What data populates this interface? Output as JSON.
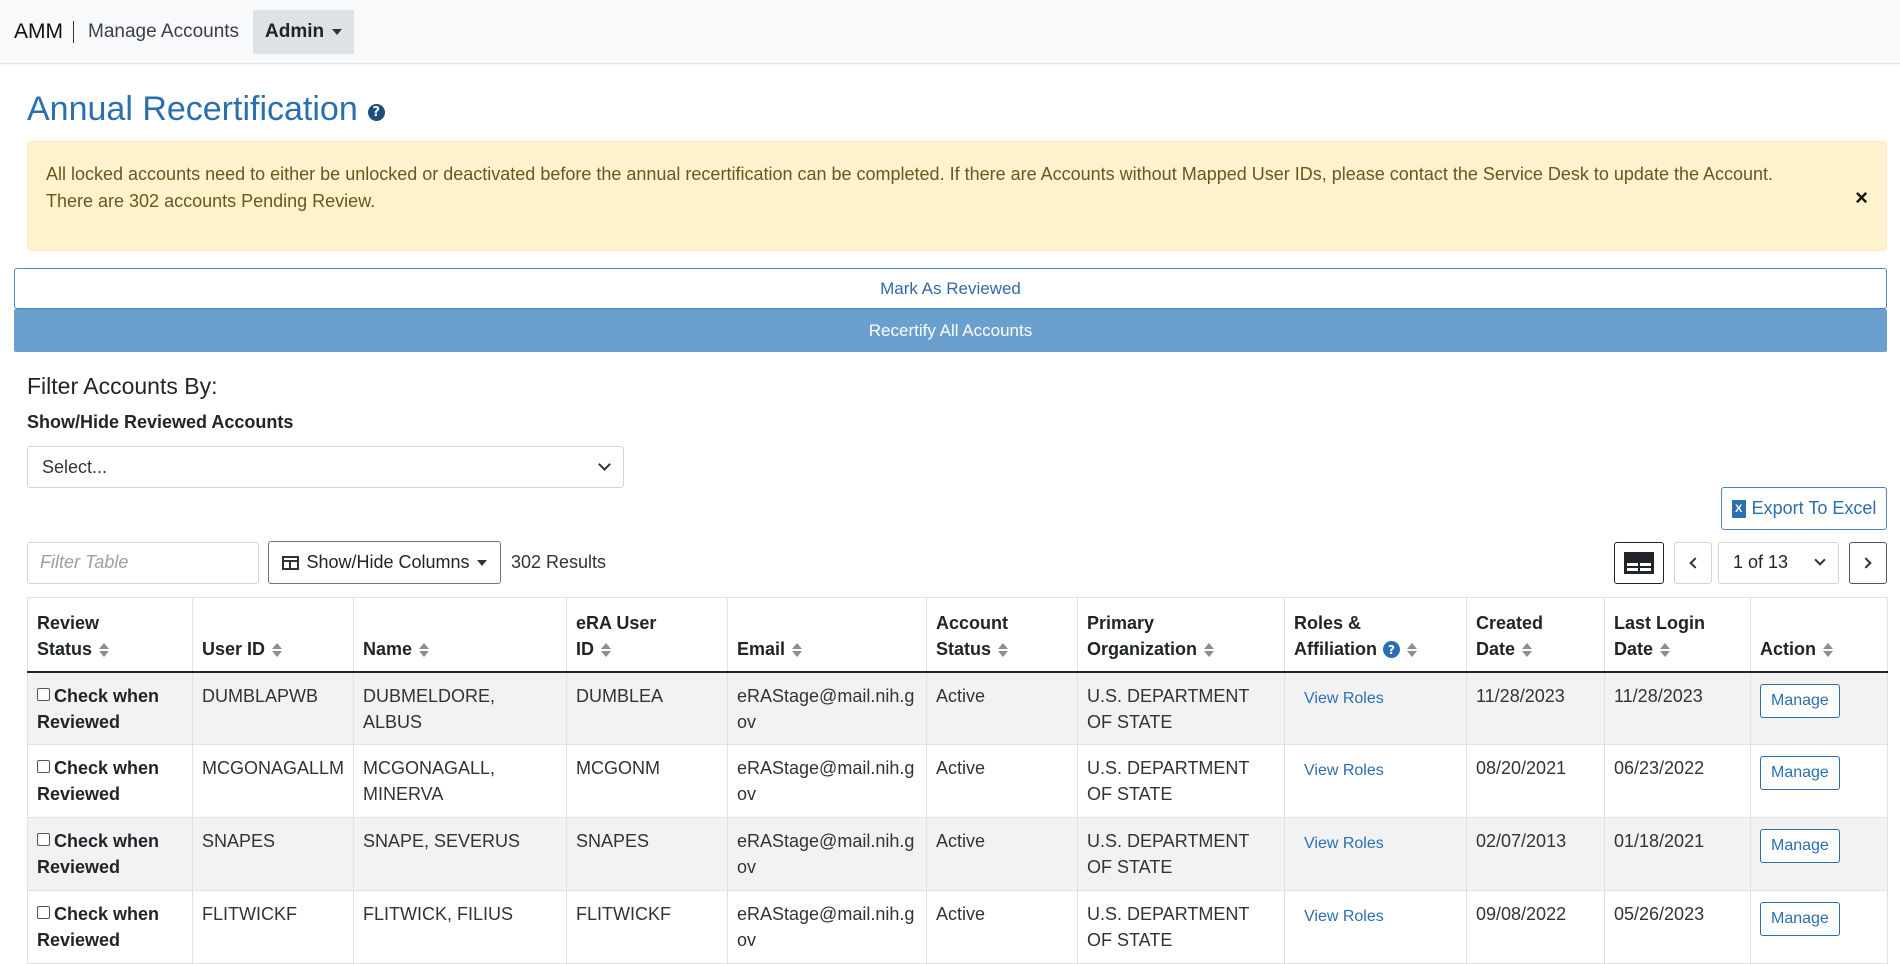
{
  "nav": {
    "brand": "AMM",
    "manage_accounts": "Manage Accounts",
    "admin": "Admin"
  },
  "page": {
    "title": "Annual Recertification",
    "help_glyph": "?"
  },
  "alert": {
    "line1": "All locked accounts need to either be unlocked or deactivated before the annual recertification can be completed. If there are Accounts without Mapped User IDs, please contact the Service Desk to update the Account.",
    "line2": "There are 302 accounts Pending Review.",
    "close": "×"
  },
  "actions": {
    "mark_reviewed": "Mark As Reviewed",
    "recertify_all": "Recertify All Accounts"
  },
  "filter": {
    "title": "Filter Accounts By:",
    "label": "Show/Hide Reviewed Accounts",
    "select_value": "Select..."
  },
  "export": {
    "label": "Export To Excel",
    "icon_glyph": "X"
  },
  "toolbar": {
    "filter_placeholder": "Filter Table",
    "show_hide_columns": "Show/Hide Columns",
    "results": "302 Results",
    "page_value": "1 of 13"
  },
  "table": {
    "headers": [
      {
        "l1": "Review",
        "l2": "Status"
      },
      {
        "l1": "",
        "l2": "User ID"
      },
      {
        "l1": "",
        "l2": "Name"
      },
      {
        "l1": "eRA User",
        "l2": "ID"
      },
      {
        "l1": "",
        "l2": "Email"
      },
      {
        "l1": "Account",
        "l2": "Status"
      },
      {
        "l1": "Primary",
        "l2": "Organization"
      },
      {
        "l1": "Roles &",
        "l2": "Affiliation"
      },
      {
        "l1": "Created",
        "l2": "Date"
      },
      {
        "l1": "Last Login",
        "l2": "Date"
      },
      {
        "l1": "",
        "l2": "Action"
      }
    ],
    "rows": [
      {
        "check": "Check when Reviewed",
        "user_id": "DUMBLAPWB",
        "name": "DUBMELDORE, ALBUS",
        "era_id": "DUMBLEA",
        "email": "eRAStage@mail.nih.gov",
        "status": "Active",
        "org": "U.S. DEPARTMENT OF STATE",
        "roles": "View Roles",
        "created": "11/28/2023",
        "last_login": "11/28/2023",
        "action": "Manage"
      },
      {
        "check": "Check when Reviewed",
        "user_id": "MCGONAGALLM",
        "name": "MCGONAGALL, MINERVA",
        "era_id": "MCGONM",
        "email": "eRAStage@mail.nih.gov",
        "status": "Active",
        "org": "U.S. DEPARTMENT OF STATE",
        "roles": "View Roles",
        "created": "08/20/2021",
        "last_login": "06/23/2022",
        "action": "Manage"
      },
      {
        "check": "Check when Reviewed",
        "user_id": "SNAPES",
        "name": "SNAPE, SEVERUS",
        "era_id": "SNAPES",
        "email": "eRAStage@mail.nih.gov",
        "status": "Active",
        "org": "U.S. DEPARTMENT OF STATE",
        "roles": "View Roles",
        "created": "02/07/2013",
        "last_login": "01/18/2021",
        "action": "Manage"
      },
      {
        "check": "Check when Reviewed",
        "user_id": "FLITWICKF",
        "name": "FLITWICK, FILIUS",
        "era_id": "FLITWICKF",
        "email": "eRAStage@mail.nih.gov",
        "status": "Active",
        "org": "U.S. DEPARTMENT OF STATE",
        "roles": "View Roles",
        "created": "09/08/2022",
        "last_login": "05/26/2023",
        "action": "Manage"
      }
    ]
  },
  "colors": {
    "primary": "#2a6fb0",
    "alert_bg": "#fff3cd",
    "recertify_bg": "#6a9fce"
  }
}
